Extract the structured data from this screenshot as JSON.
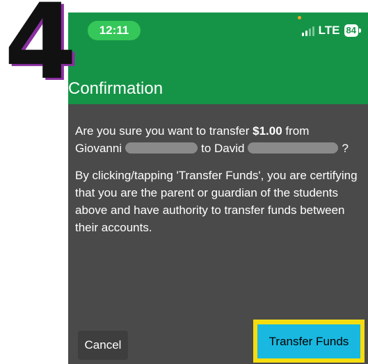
{
  "step_number": "4",
  "status_bar": {
    "time": "12:11",
    "network": "LTE",
    "battery": "84",
    "icons": [
      "signal-icon",
      "battery-icon"
    ]
  },
  "header": {
    "title": "Confirmation"
  },
  "content": {
    "question_prefix": "Are you sure you want to transfer ",
    "amount": "$1.00",
    "question_from": " from",
    "from_name": "Giovanni",
    "to_text": "to David",
    "question_end": "?",
    "disclaimer": "By clicking/tapping 'Transfer Funds', you are certifying that you are the parent or guardian of the students above and have authority to transfer funds between their accounts."
  },
  "buttons": {
    "cancel": "Cancel",
    "transfer": "Transfer Funds"
  },
  "colors": {
    "header": "#159447",
    "panel": "#4a4a4a",
    "highlight": "#f5dd10",
    "transfer": "#19b8e0"
  }
}
